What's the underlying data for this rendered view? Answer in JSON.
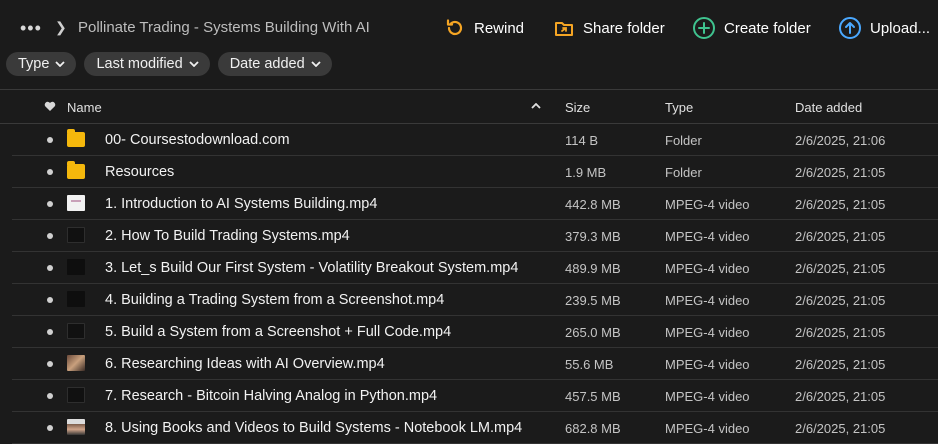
{
  "breadcrumb": {
    "more_icon": "more-dots-icon",
    "separator_icon": "chevron-right-icon",
    "current": "Pollinate Trading - Systems Building With AI"
  },
  "actions": [
    {
      "id": "rewind",
      "label": "Rewind",
      "icon": "rewind-icon",
      "color": "#f5a524"
    },
    {
      "id": "share",
      "label": "Share folder",
      "icon": "share-folder-icon",
      "color": "#f5a524"
    },
    {
      "id": "create",
      "label": "Create folder",
      "icon": "add-circle-icon",
      "color": "#3fc38f"
    },
    {
      "id": "upload",
      "label": "Upload...",
      "icon": "upload-circle-icon",
      "color": "#4aa8ff"
    }
  ],
  "filters": [
    {
      "label": "Type"
    },
    {
      "label": "Last modified"
    },
    {
      "label": "Date added"
    }
  ],
  "columns": {
    "name": "Name",
    "size": "Size",
    "type": "Type",
    "date": "Date added",
    "sort_icon": "sort-ascending-icon",
    "favorite_icon": "heart-icon"
  },
  "rows": [
    {
      "name": "00- Coursestodownload.com",
      "size": "114 B",
      "type": "Folder",
      "date": "2/6/2025, 21:06",
      "thumb": "folder"
    },
    {
      "name": "Resources",
      "size": "1.9 MB",
      "type": "Folder",
      "date": "2/6/2025, 21:05",
      "thumb": "folder"
    },
    {
      "name": "1. Introduction to AI Systems Building.mp4",
      "size": "442.8 MB",
      "type": "MPEG-4 video",
      "date": "2/6/2025, 21:05",
      "thumb": "v-light"
    },
    {
      "name": "2. How To Build Trading Systems.mp4",
      "size": "379.3 MB",
      "type": "MPEG-4 video",
      "date": "2/6/2025, 21:05",
      "thumb": "v-dark"
    },
    {
      "name": "3. Let_s Build Our First System - Volatility Breakout System.mp4",
      "size": "489.9 MB",
      "type": "MPEG-4 video",
      "date": "2/6/2025, 21:05",
      "thumb": "v-chart"
    },
    {
      "name": "4. Building a Trading System from a Screenshot.mp4",
      "size": "239.5 MB",
      "type": "MPEG-4 video",
      "date": "2/6/2025, 21:05",
      "thumb": "v-chart"
    },
    {
      "name": "5. Build a System from a Screenshot + Full Code.mp4",
      "size": "265.0 MB",
      "type": "MPEG-4 video",
      "date": "2/6/2025, 21:05",
      "thumb": "v-dark"
    },
    {
      "name": "6. Researching Ideas with AI Overview.mp4",
      "size": "55.6 MB",
      "type": "MPEG-4 video",
      "date": "2/6/2025, 21:05",
      "thumb": "v-photo"
    },
    {
      "name": "7. Research - Bitcoin Halving Analog in Python.mp4",
      "size": "457.5 MB",
      "type": "MPEG-4 video",
      "date": "2/6/2025, 21:05",
      "thumb": "v-dark"
    },
    {
      "name": "8. Using Books and Videos to Build Systems - Notebook LM.mp4",
      "size": "682.8 MB",
      "type": "MPEG-4 video",
      "date": "2/6/2025, 21:05",
      "thumb": "v-face"
    }
  ]
}
